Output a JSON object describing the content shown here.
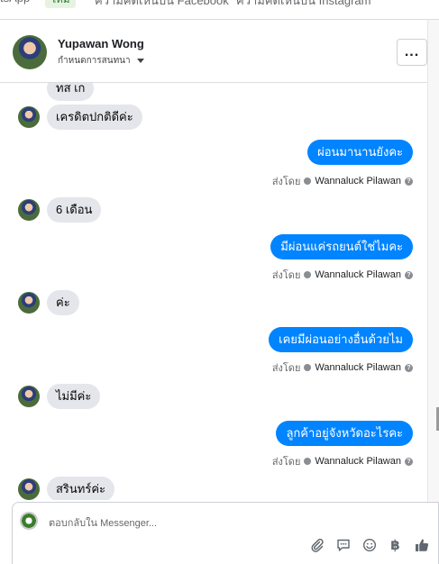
{
  "tabs": {
    "items": [
      {
        "label": "tsApp"
      },
      {
        "label": "ความคิดเห็นบน Facebook"
      },
      {
        "label": "ความคิดเห็นบน Instagram"
      }
    ],
    "badge": "ใหม่"
  },
  "header": {
    "contact_name": "Yupawan Wong",
    "assign_label": "กำหนดการสนทนา",
    "more_label": "..."
  },
  "messages": [
    {
      "dir": "in",
      "text": "ทส เก"
    },
    {
      "dir": "in",
      "text": "เครดิตปกติดีค่ะ"
    },
    {
      "dir": "out",
      "text": "ผ่อนมานานยังคะ",
      "sent_prefix": "ส่งโดย",
      "sender": "Wannaluck Pilawan"
    },
    {
      "dir": "in",
      "text": "6 เดือน"
    },
    {
      "dir": "out",
      "text": "มีผ่อนแค่รถยนต์ใช่ไมคะ",
      "sent_prefix": "ส่งโดย",
      "sender": "Wannaluck Pilawan"
    },
    {
      "dir": "in",
      "text": "ค่ะ"
    },
    {
      "dir": "out",
      "text": "เคยมีผ่อนอย่างอื่นด้วยไม",
      "sent_prefix": "ส่งโดย",
      "sender": "Wannaluck Pilawan"
    },
    {
      "dir": "in",
      "text": "ไม่มีค่ะ"
    },
    {
      "dir": "out",
      "text": "ลูกค้าอยู่จังหวัดอะไรคะ",
      "sent_prefix": "ส่งโดย",
      "sender": "Wannaluck Pilawan"
    },
    {
      "dir": "in",
      "text": "สรินทร์ค่ะ"
    }
  ],
  "composer": {
    "placeholder": "ตอบกลับใน Messenger...",
    "icons": [
      "attach-icon",
      "saved-reply-icon",
      "emoji-icon",
      "baht-icon",
      "thumbs-up-icon"
    ],
    "baht_glyph": "฿"
  },
  "colors": {
    "accent": "#0084ff",
    "incoming": "#e4e6eb"
  }
}
